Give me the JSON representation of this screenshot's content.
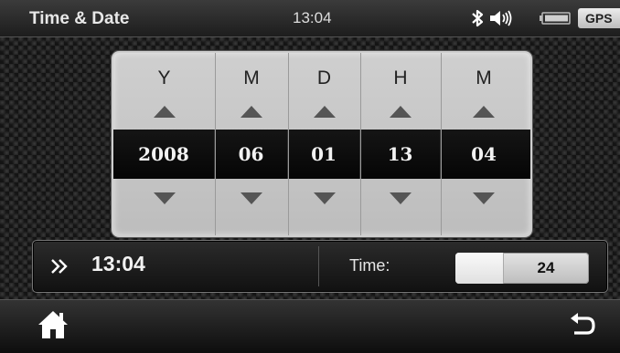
{
  "status_bar": {
    "title": "Time & Date",
    "clock": "13:04",
    "icons": [
      "bluetooth-icon",
      "speaker-icon",
      "battery-icon"
    ],
    "gps_label": "GPS"
  },
  "picker": {
    "columns": [
      {
        "header": "Y",
        "value": "2008"
      },
      {
        "header": "M",
        "value": "06"
      },
      {
        "header": "D",
        "value": "01"
      },
      {
        "header": "H",
        "value": "13"
      },
      {
        "header": "M",
        "value": "04"
      }
    ]
  },
  "info_bar": {
    "current_time": "13:04",
    "time_label": "Time:",
    "time_format": "24"
  },
  "bottom_bar": {
    "icons": [
      "home-icon",
      "back-icon"
    ]
  },
  "colors": {
    "value_band": "#0a0a0a",
    "panel": "#c8c8c8",
    "background": "#1a1a1a"
  }
}
